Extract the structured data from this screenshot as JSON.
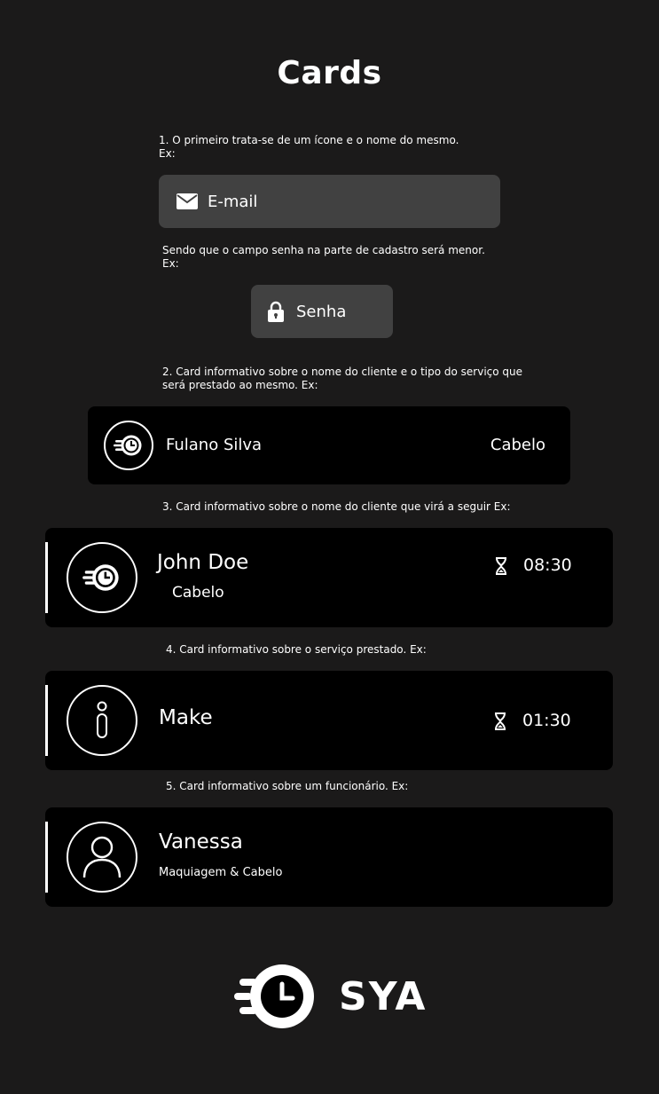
{
  "page": {
    "title": "Cards"
  },
  "notes": {
    "n1": "1. O primeiro trata-se de um ícone e o nome do mesmo.\nEx:",
    "n1b": "Sendo que o campo senha na parte de cadastro será menor.\nEx:",
    "n2": "2. Card informativo sobre o nome do cliente e o tipo do serviço que\nserá prestado ao mesmo. Ex:",
    "n3": "3. Card informativo sobre o nome do cliente que virá a seguir Ex:",
    "n4": "4. Card informativo sobre o serviço prestado. Ex:",
    "n5": "5. Card informativo sobre um funcionário. Ex:"
  },
  "email_field": {
    "label": "E-mail",
    "icon": "mail-icon"
  },
  "password_field": {
    "label": "Senha",
    "icon": "lock-icon"
  },
  "card_client": {
    "name": "Fulano Silva",
    "service": "Cabelo",
    "icon": "fast-clock-icon"
  },
  "card_next": {
    "name": "John Doe",
    "service": "Cabelo",
    "time": "08:30",
    "icon": "fast-clock-icon",
    "time_icon": "hourglass-icon"
  },
  "card_service": {
    "name": "Make",
    "time": "01:30",
    "icon": "info-icon",
    "time_icon": "hourglass-icon"
  },
  "card_employee": {
    "name": "Vanessa",
    "role": "Maquiagem & Cabelo",
    "icon": "user-icon"
  },
  "logo": {
    "wordmark": "SYA"
  },
  "colors": {
    "background": "#1b1a1a",
    "card": "#000000",
    "field": "#414141",
    "text": "#ffffff"
  }
}
